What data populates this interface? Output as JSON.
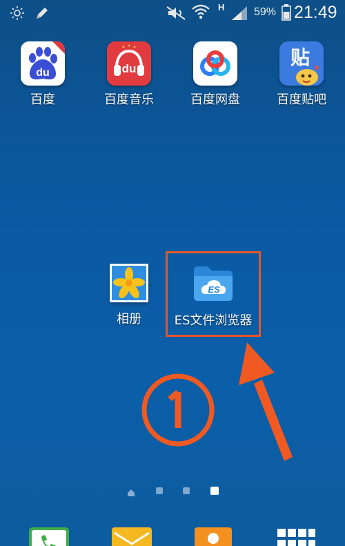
{
  "status_bar": {
    "battery_percent": "59%",
    "time": "21:49",
    "network_type": "H",
    "icons": [
      "brightness-icon",
      "edit-icon",
      "mute-icon",
      "wifi-icon",
      "signal-icon",
      "battery-icon"
    ]
  },
  "home_screen": {
    "apps": [
      {
        "label": "百度",
        "icon": "baidu-icon"
      },
      {
        "label": "百度音乐",
        "icon": "baidu-music-icon"
      },
      {
        "label": "百度网盘",
        "icon": "baidu-netdisk-icon"
      },
      {
        "label": "百度贴吧",
        "icon": "baidu-tieba-icon"
      },
      {
        "label": "相册",
        "icon": "gallery-icon"
      },
      {
        "label": "ES文件浏览器",
        "icon": "es-file-explorer-icon"
      }
    ],
    "icon_texts": {
      "baidu": "du",
      "baidu_music": "du",
      "tieba": "贴"
    }
  },
  "annotation": {
    "step_number": "①",
    "highlight_color": "#e8562a"
  },
  "page_indicator": {
    "pages": 4,
    "active_page": 4
  },
  "dock": {
    "items": [
      "phone-icon",
      "messages-icon",
      "contacts-icon",
      "app-drawer-icon"
    ]
  },
  "colors": {
    "background_top": "#0e4f87",
    "background_bottom": "#0c5c9f",
    "accent_orange": "#f05a22"
  }
}
